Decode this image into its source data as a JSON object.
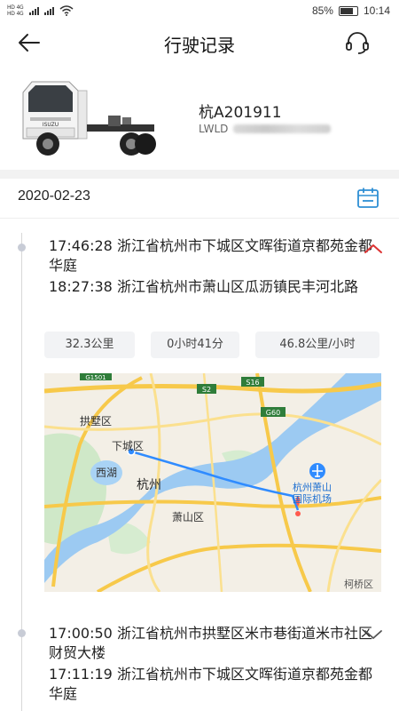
{
  "status_bar": {
    "sim1": "HD 4G",
    "sim2": "HD 4G",
    "battery": "85%",
    "time": "10:14"
  },
  "header": {
    "title": "行驶记录"
  },
  "vehicle": {
    "truck_logo": "ISUZU",
    "plate": "杭A201911",
    "vin_prefix": "LWLD"
  },
  "date": "2020-02-23",
  "trips": [
    {
      "start": "17:46:28 浙江省杭州市下城区文晖街道京都苑金都华庭",
      "end": "18:27:38 浙江省杭州市萧山区瓜沥镇民丰河北路",
      "expanded": true,
      "stats": {
        "distance": "32.3公里",
        "duration": "0小时41分",
        "speed": "46.8公里/小时"
      }
    },
    {
      "start": "17:00:50 浙江省杭州市拱墅区米市巷街道米市社区财贸大楼",
      "end": "17:11:19 浙江省杭州市下城区文晖街道京都苑金都华庭",
      "expanded": false
    }
  ],
  "map": {
    "labels": {
      "gongshu": "拱墅区",
      "xiacheng": "下城区",
      "xihu": "西湖",
      "hangzhou": "杭州",
      "xiaoshan": "萧山区",
      "airport1": "杭州萧山",
      "airport2": "国际机场",
      "kejiao": "柯桥区"
    },
    "road_shields": {
      "s2": "S2",
      "s16": "S16",
      "g60": "G60",
      "g1501": "G1501"
    }
  }
}
